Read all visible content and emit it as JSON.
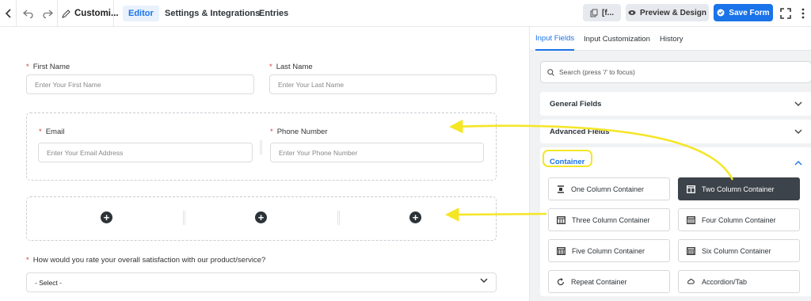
{
  "topbar": {
    "title": "Customi...",
    "tabs": [
      "Editor",
      "Settings & Integrations",
      "Entries"
    ],
    "shortcode_label": "[f...",
    "preview_label": "Preview & Design",
    "save_label": "Save Form"
  },
  "form": {
    "first_name": {
      "label": "First Name",
      "placeholder": "Enter Your First Name"
    },
    "last_name": {
      "label": "Last Name",
      "placeholder": "Enter Your Last Name"
    },
    "email": {
      "label": "Email",
      "placeholder": "Enter Your Email Address"
    },
    "phone": {
      "label": "Phone Number",
      "placeholder": "Enter Your Phone Number"
    },
    "satisfaction": {
      "label": "How would you rate your overall satisfaction with our product/service?",
      "value": "- Select -"
    },
    "required_mark": "*",
    "plus": "+"
  },
  "sidebar": {
    "tabs": [
      "Input Fields",
      "Input Customization",
      "History"
    ],
    "search_placeholder": "Search (press '/' to focus)",
    "sections": [
      "General Fields",
      "Advanced Fields",
      "Container"
    ],
    "containers": [
      "One Column Container",
      "Two Column Container",
      "Three Column Container",
      "Four Column Container",
      "Five Column Container",
      "Six Column Container",
      "Repeat Container",
      "Accordion/Tab"
    ]
  },
  "colors": {
    "accent": "#1a73e8",
    "highlight": "#f5e625"
  }
}
